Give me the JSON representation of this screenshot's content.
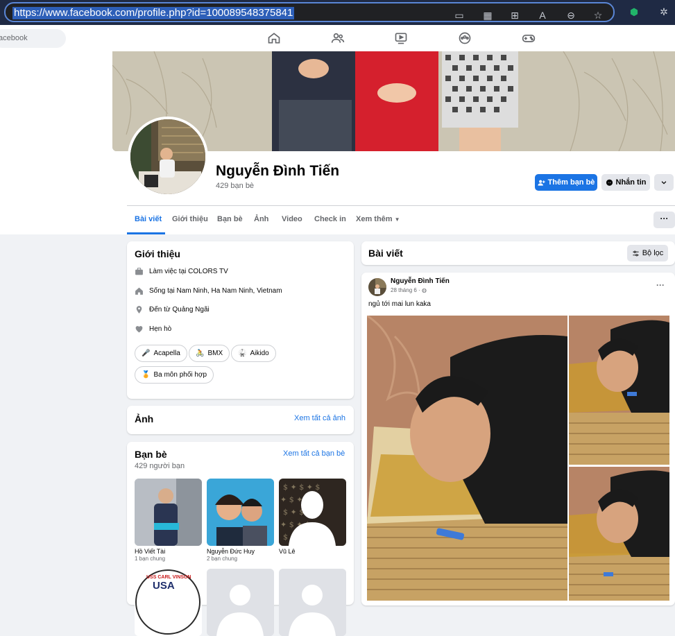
{
  "browser": {
    "url": "https://www.facebook.com/profile.php?id=100089548375841"
  },
  "fb_nav": {
    "search_placeholder": "acebook"
  },
  "profile": {
    "name": "Nguyễn Đình Tiến",
    "friend_count": "429 bạn bè",
    "add_friend_label": "Thêm bạn bè",
    "message_label": "Nhắn tin"
  },
  "tabs": [
    "Bài viết",
    "Giới thiệu",
    "Bạn bè",
    "Ảnh",
    "Video",
    "Check in",
    "Xem thêm"
  ],
  "intro": {
    "title": "Giới thiệu",
    "rows": [
      {
        "icon": "briefcase-icon",
        "text": "Làm việc tại COLORS TV"
      },
      {
        "icon": "home-icon",
        "text": "Sống tại Nam Ninh, Ha Nam Ninh, Vietnam"
      },
      {
        "icon": "location-pin-icon",
        "text": "Đến từ Quảng Ngãi"
      },
      {
        "icon": "heart-icon",
        "text": "Hẹn hò"
      }
    ],
    "hobbies": [
      "Acapella",
      "BMX",
      "Aikido",
      "Ba môn phối hợp"
    ]
  },
  "photos_card": {
    "title": "Ảnh",
    "see_all": "Xem tất cả ảnh"
  },
  "friends_card": {
    "title": "Bạn bè",
    "count": "429 người bạn",
    "see_all": "Xem tất cả bạn bè",
    "friends": [
      {
        "name": "Hồ Viết Tài",
        "mutual": "1 bạn chung"
      },
      {
        "name": "Nguyễn Đức Huy",
        "mutual": "2 bạn chung"
      },
      {
        "name": "Vũ Lê",
        "mutual": ""
      }
    ],
    "badge_text": "USS CARL VINSON",
    "badge_sub": "USA"
  },
  "posts_header": {
    "title": "Bài viết",
    "filter_label": "Bộ lọc"
  },
  "post": {
    "author": "Nguyễn Đình Tiến",
    "date": "28 tháng 6 ·",
    "text": "ngủ tới mai lun kaka"
  },
  "colors": {
    "accent": "#1b74e4",
    "background": "#f0f2f5"
  }
}
